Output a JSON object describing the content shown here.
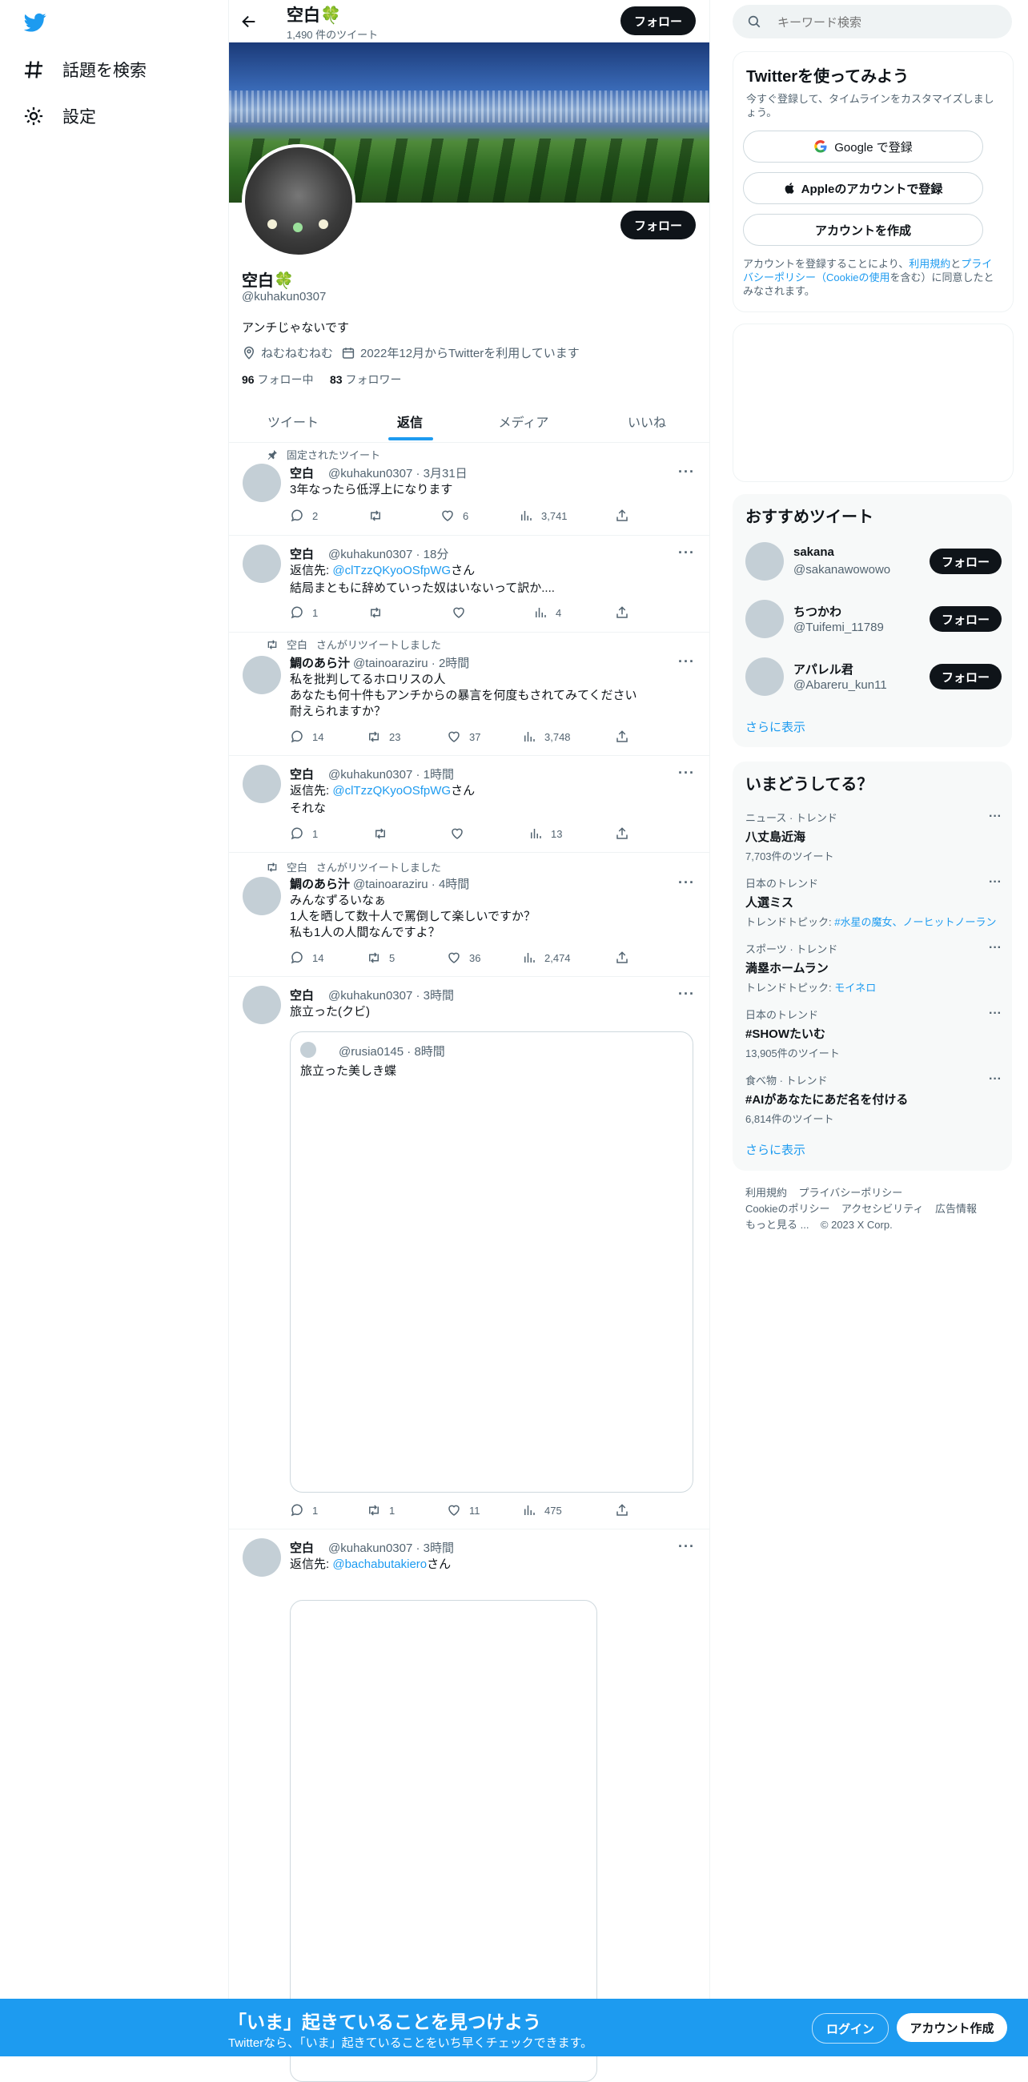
{
  "nav": {
    "explore_label": "話題を検索",
    "settings_label": "設定"
  },
  "header": {
    "name": "空白🍀",
    "tweet_count": "1,490 件のツイート",
    "follow_label": "フォロー"
  },
  "profile": {
    "name": "空白🍀",
    "handle": "@kuhakun0307",
    "follow_label": "フォロー",
    "bio": "アンチじゃないです",
    "location": "ねむねむねむ",
    "joined": "2022年12月からTwitterを利用しています",
    "following_count": "96",
    "following_label": "フォロー中",
    "followers_count": "83",
    "followers_label": "フォロワー"
  },
  "tabs": [
    "ツイート",
    "返信",
    "メディア",
    "いいね"
  ],
  "tweets": [
    {
      "pinned_label": "固定されたツイート",
      "name": "空白",
      "meta": "@kuhakun0307 · 3月31日",
      "text": "3年なったら低浮上になります",
      "replies": "2",
      "retweets": "",
      "likes": "6",
      "views": "3,741"
    },
    {
      "name": "空白",
      "meta": "@kuhakun0307 · 18分",
      "reply_prefix": "返信先: ",
      "reply_to": "@clTzzQKyoOSfpWG",
      "reply_suffix": "さん",
      "text": "結局まともに辞めていった奴はいないって訳か....",
      "replies": "1",
      "retweets": "",
      "likes": "",
      "views": "4"
    },
    {
      "rt_by": "空白",
      "rt_label": "さんがリツイートしました",
      "name": "鯛のあら汁",
      "meta": "@tainoaraziru · 2時間",
      "lines": [
        "私を批判してるホロリスの人",
        "あなたも何十件もアンチからの暴言を何度もされてみてください",
        "耐えられますか？"
      ],
      "replies": "14",
      "retweets": "23",
      "likes": "37",
      "views": "3,748"
    },
    {
      "name": "空白",
      "meta": "@kuhakun0307 · 1時間",
      "reply_prefix": "返信先: ",
      "reply_to": "@clTzzQKyoOSfpWG",
      "reply_suffix": "さん",
      "text": "それな",
      "replies": "1",
      "retweets": "",
      "likes": "",
      "views": "13"
    },
    {
      "rt_by": "空白",
      "rt_label": "さんがリツイートしました",
      "name": "鯛のあら汁",
      "meta": "@tainoaraziru · 4時間",
      "lines": [
        "みんなずるいなぁ",
        "1人を晒して数十人で罵倒して楽しいですか？",
        "私も1人の人間なんですよ？"
      ],
      "replies": "14",
      "retweets": "5",
      "likes": "36",
      "views": "2,474"
    },
    {
      "name": "空白",
      "meta": "@kuhakun0307 · 3時間",
      "text": "旅立った(クビ)",
      "quote_meta": "@rusia0145 · 8時間",
      "quote_text": "旅立った美しき蝶",
      "replies": "1",
      "retweets": "1",
      "likes": "11",
      "views": "475"
    },
    {
      "name": "空白",
      "meta": "@kuhakun0307 · 3時間",
      "reply_prefix": "返信先: ",
      "reply_to": "@bachabutakiero",
      "reply_suffix": "さん"
    }
  ],
  "right": {
    "search_placeholder": "キーワード検索",
    "signup": {
      "title": "Twitterを使ってみよう",
      "subtitle": "今すぐ登録して、タイムラインをカスタマイズしましょう。",
      "google": "Google で登録",
      "apple": "Appleのアカウントで登録",
      "create": "アカウントを作成",
      "legal_1": "アカウントを登録することにより、",
      "terms": "利用規約",
      "and": "と",
      "privacy": "プライバシーポリシー（Cookieの使用",
      "legal_2": "を含む）に同意したとみなされます。"
    },
    "recommend": {
      "title": "おすすめツイート",
      "users": [
        {
          "name": "sakana",
          "handle": "@sakanawowowo"
        },
        {
          "name": "ちつかわ",
          "handle": "@Tuifemi_11789"
        },
        {
          "name": "アパレル君",
          "handle": "@Abareru_kun11"
        }
      ],
      "follow_label": "フォロー",
      "more": "さらに表示"
    },
    "trends": {
      "title": "いまどうしてる？",
      "items": [
        {
          "category": "ニュース · トレンド",
          "title": "八丈島近海",
          "sub": "7,703件のツイート",
          "sub_link": ""
        },
        {
          "category": "日本のトレンド",
          "title": "人選ミス",
          "sub": "トレンドトピック: ",
          "sub_link": "#水星の魔女、ノーヒットノーラン"
        },
        {
          "category": "スポーツ · トレンド",
          "title": "満塁ホームラン",
          "sub": "トレンドトピック: ",
          "sub_link": "モイネロ"
        },
        {
          "category": "日本のトレンド",
          "title": "#SHOWたいむ",
          "sub": "13,905件のツイート",
          "sub_link": ""
        },
        {
          "category": "食べ物 · トレンド",
          "title": "#AIがあなたにあだ名を付ける",
          "sub": "6,814件のツイート",
          "sub_link": ""
        }
      ],
      "more": "さらに表示"
    },
    "footer": {
      "terms": "利用規約",
      "privacy": "プライバシーポリシー",
      "cookie": "Cookieのポリシー",
      "accessibility": "アクセシビリティ",
      "ads": "広告情報",
      "more": "もっと見る ...",
      "copyright": "© 2023 X Corp."
    }
  },
  "bottom_bar": {
    "title": "「いま」起きていることを見つけよう",
    "subtitle": "Twitterなら、「いま」起きていることをいち早くチェックできます。",
    "login": "ログイン",
    "signup": "アカウント作成"
  }
}
